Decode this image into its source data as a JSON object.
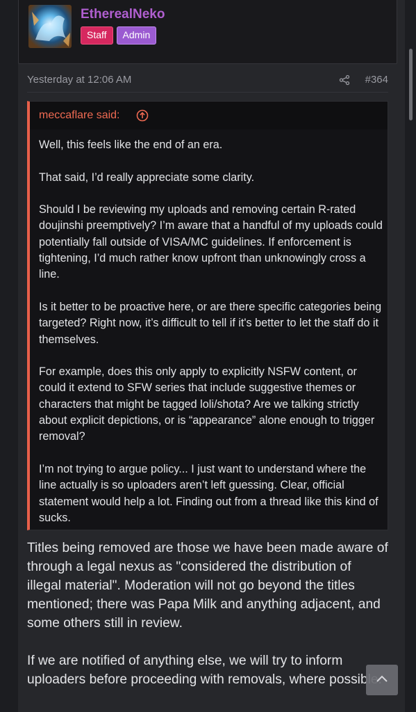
{
  "user": {
    "name": "EtherealNeko",
    "badges": [
      "Staff",
      "Admin"
    ]
  },
  "post": {
    "timestamp": "Yesterday at 12:06 AM",
    "number": "#364"
  },
  "quote": {
    "author": "meccaflare said:",
    "paragraphs": [
      "Well, this feels like the end of an era.",
      "That said, I’d really appreciate some clarity.",
      "Should I be reviewing my uploads and removing certain R-rated doujinshi preemptively? I’m aware that a handful of my uploads could potentially fall outside of VISA/MC guidelines. If enforcement is tightening, I’d much rather know upfront than unknowingly cross a line.",
      "Is it better to be proactive here, or are there specific categories being targeted? Right now, it’s difficult to tell if it's better to let the staff do it themselves.",
      "For example, does this only apply to explicitly NSFW content, or could it extend to SFW series that include suggestive themes or characters that might be tagged loli/shota? Are we talking strictly about explicit depictions, or is “appearance” alone enough to trigger removal?",
      "I’m not trying to argue policy... I just want to understand where the line actually is so uploaders aren’t left guessing. Clear, official statement would help a lot. Finding out from a thread like this kind of sucks."
    ]
  },
  "reply": {
    "paragraphs": [
      "Titles being removed are those we have been made aware of through a legal nexus as \"considered the distribution of illegal material\". Moderation will not go beyond the titles mentioned; there was Papa Milk and anything adjacent, and some others still in review.",
      "If we are notified of anything else, we will try to inform uploaders before proceeding with removals, where possible."
    ]
  },
  "colors": {
    "username": "#b05fd0",
    "staff_badge": "#d6285f",
    "admin_badge": "#9b5bd1",
    "quote_accent": "#e8604a"
  },
  "icons": {
    "share": "share-icon",
    "quote_jump": "arrow-up-circle-icon",
    "scroll_top": "chevron-up-icon"
  }
}
